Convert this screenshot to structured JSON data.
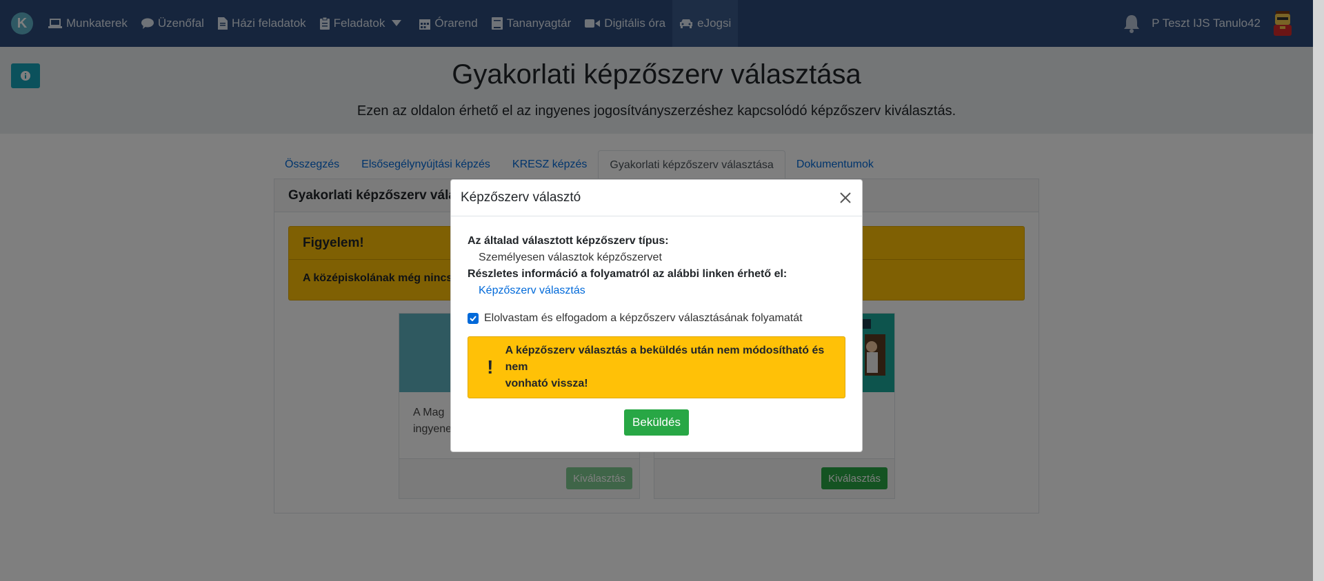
{
  "nav": {
    "items": [
      {
        "label": "Munkaterek",
        "icon": "laptop-icon"
      },
      {
        "label": "Üzenőfal",
        "icon": "comment-icon"
      },
      {
        "label": "Házi feladatok",
        "icon": "file-icon"
      },
      {
        "label": "Feladatok",
        "icon": "clipboard-icon"
      },
      {
        "label": "Órarend",
        "icon": "calendar-icon"
      },
      {
        "label": "Tananyagtár",
        "icon": "book-icon"
      },
      {
        "label": "Digitális óra",
        "icon": "video-icon"
      },
      {
        "label": "eJogsi",
        "icon": "car-icon"
      }
    ],
    "logo_letter": "K",
    "username": "P Teszt IJS Tanulo42"
  },
  "hero": {
    "title": "Gyakorlati képzőszerv választása",
    "subtitle": "Ezen az oldalon érhető el az ingyenes jogosítványszerzéshez kapcsolódó képzőszerv kiválasztás."
  },
  "tabs": [
    "Összegzés",
    "Elsősegélynyújtási képzés",
    "KRESZ képzés",
    "Gyakorlati képzőszerv választása",
    "Dokumentumok"
  ],
  "card": {
    "title": "Gyakorlati képzőszerv vála",
    "alert_title": "Figyelem!",
    "alert_body": "A középiskolának még nincs e",
    "left_text_line1": "A Mag",
    "left_text_line2": "ingyene",
    "select_label": "Kiválasztás"
  },
  "modal": {
    "title": "Képzőszerv választó",
    "type_label": "Az általad választott képzőszerv típus:",
    "type_value": "Személyesen választok képzőszervet",
    "info_label": "Részletes információ a folyamatról az alábbi linken érhető el:",
    "info_link": "Képzőszerv választás",
    "checkbox_label": "Elolvastam és elfogadom a képzőszerv választásának folyamatát",
    "warning_mark": "!",
    "warning_line1": "A képzőszerv választás a beküldés után nem módosítható és nem",
    "warning_line2": "vonható vissza!",
    "submit_label": "Beküldés"
  },
  "colors": {
    "nav_bg": "#2c4a7a",
    "accent": "#0069d9",
    "success": "#28a745",
    "warning": "#ffc107",
    "info": "#17a2b8"
  }
}
